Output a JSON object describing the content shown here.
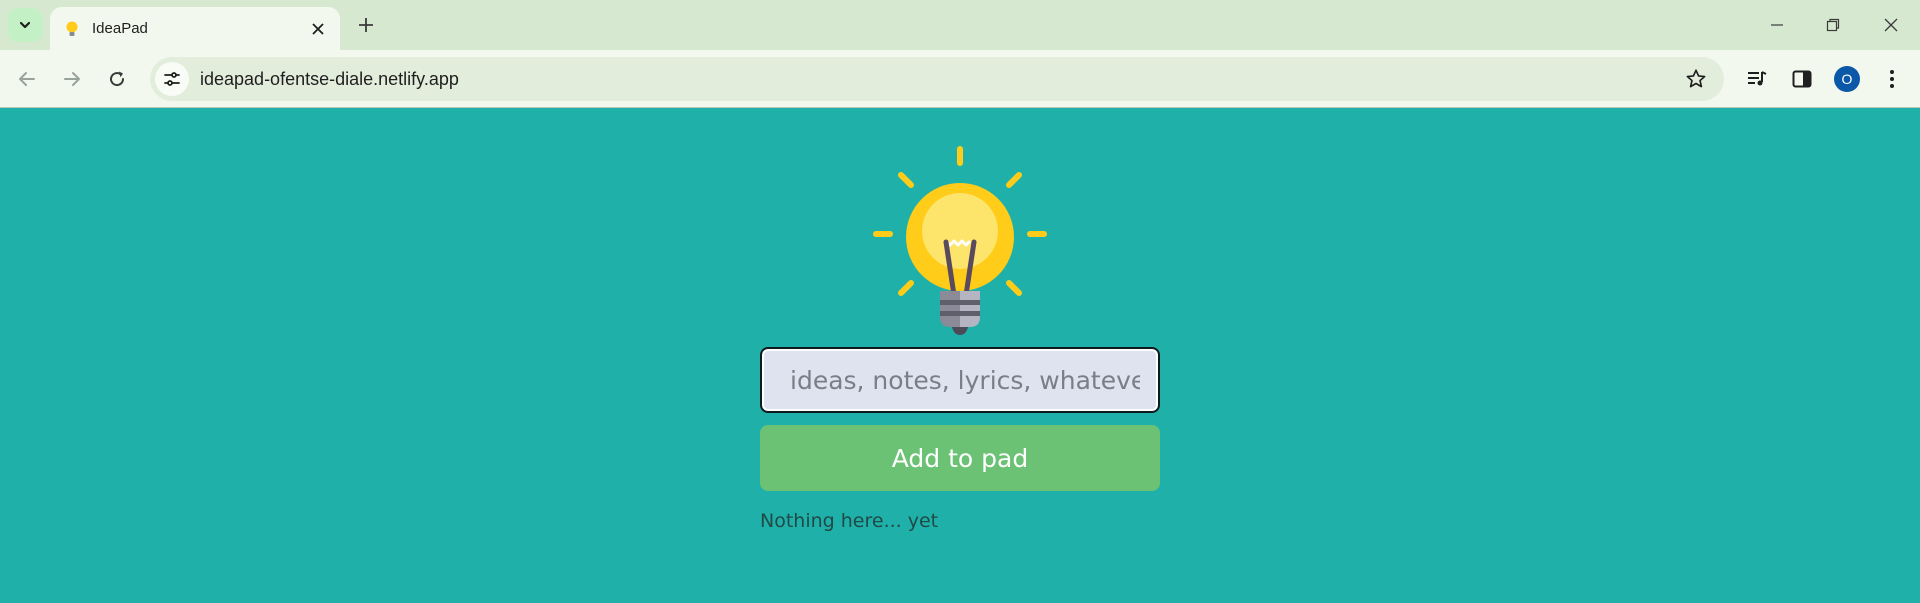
{
  "browser": {
    "tab_title": "IdeaPad",
    "url": "ideapad-ofentse-diale.netlify.app",
    "profile_initial": "O",
    "icons": {
      "tab_search": "chevron-down-icon",
      "tab_close": "close-icon",
      "new_tab": "plus-icon",
      "back": "arrow-left-icon",
      "forward": "arrow-right-icon",
      "reload": "reload-icon",
      "site_info": "site-settings-icon",
      "bookmark": "star-icon",
      "media": "media-controls-icon",
      "side_panel": "side-panel-icon",
      "menu": "kebab-menu-icon"
    }
  },
  "app": {
    "logo": "lightbulb-icon",
    "input_placeholder": "ideas, notes, lyrics, whatever...",
    "input_value": "",
    "add_button_label": "Add to pad",
    "empty_message": "Nothing here... yet"
  },
  "colors": {
    "page_background": "#20b0aa",
    "button": "#6bc174",
    "input_background": "#dfe3ef",
    "bulb_yellow": "#ffcc1a"
  }
}
